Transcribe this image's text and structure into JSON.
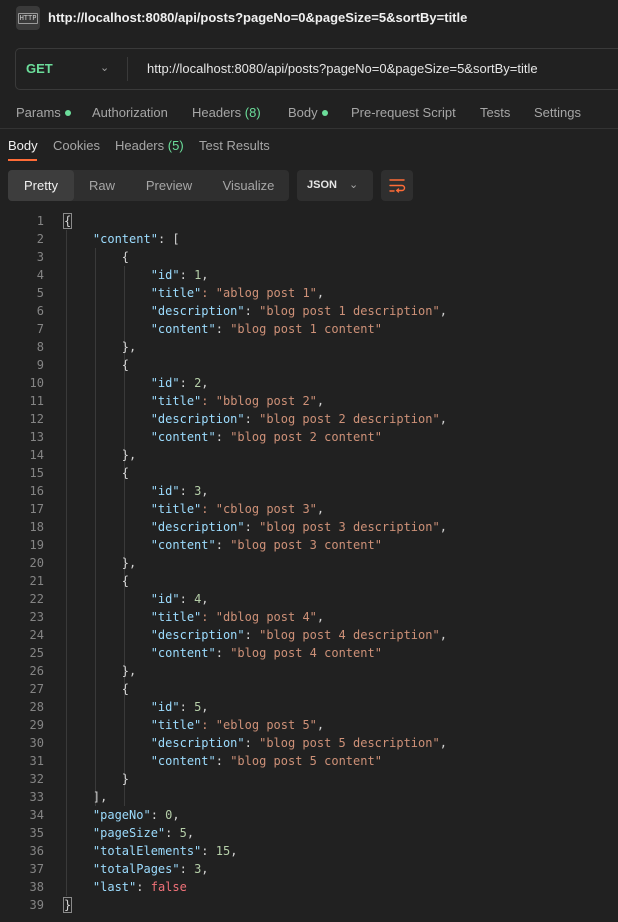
{
  "window": {
    "title_url": "http://localhost:8080/api/posts?pageNo=0&pageSize=5&sortBy=title",
    "icon": "http-icon"
  },
  "request": {
    "method": "GET",
    "url": "http://localhost:8080/api/posts?pageNo=0&pageSize=5&sortBy=title",
    "tabs": [
      "Params",
      "Authorization",
      "Headers",
      "Body",
      "Pre-request Script",
      "Tests",
      "Settings"
    ],
    "headers_count": "(8)"
  },
  "response": {
    "tabs": [
      "Body",
      "Cookies",
      "Headers",
      "Test Results"
    ],
    "headers_count": "(5)",
    "views": [
      "Pretty",
      "Raw",
      "Preview",
      "Visualize"
    ],
    "format": "JSON"
  },
  "colors": {
    "accent": "#ff6c37",
    "method_get": "#6bdd9a",
    "key": "#9cdcfe",
    "string": "#ce9178",
    "number": "#b5cea8"
  },
  "posts": [
    {
      "id": "1",
      "title": "ablog post 1",
      "description": "blog post 1 description",
      "content": "blog post 1 content"
    },
    {
      "id": "2",
      "title": "bblog post 2",
      "description": "blog post 2 description",
      "content": "blog post 2 content"
    },
    {
      "id": "3",
      "title": "cblog post 3",
      "description": "blog post 3 description",
      "content": "blog post 3 content"
    },
    {
      "id": "4",
      "title": "dblog post 4",
      "description": "blog post 4 description",
      "content": "blog post 4 content"
    },
    {
      "id": "5",
      "title": "eblog post 5",
      "description": "blog post 5 description",
      "content": "blog post 5 content"
    }
  ],
  "paging": {
    "pageNo": "0",
    "pageSize": "5",
    "totalElements": "15",
    "totalPages": "3",
    "last": "false"
  }
}
